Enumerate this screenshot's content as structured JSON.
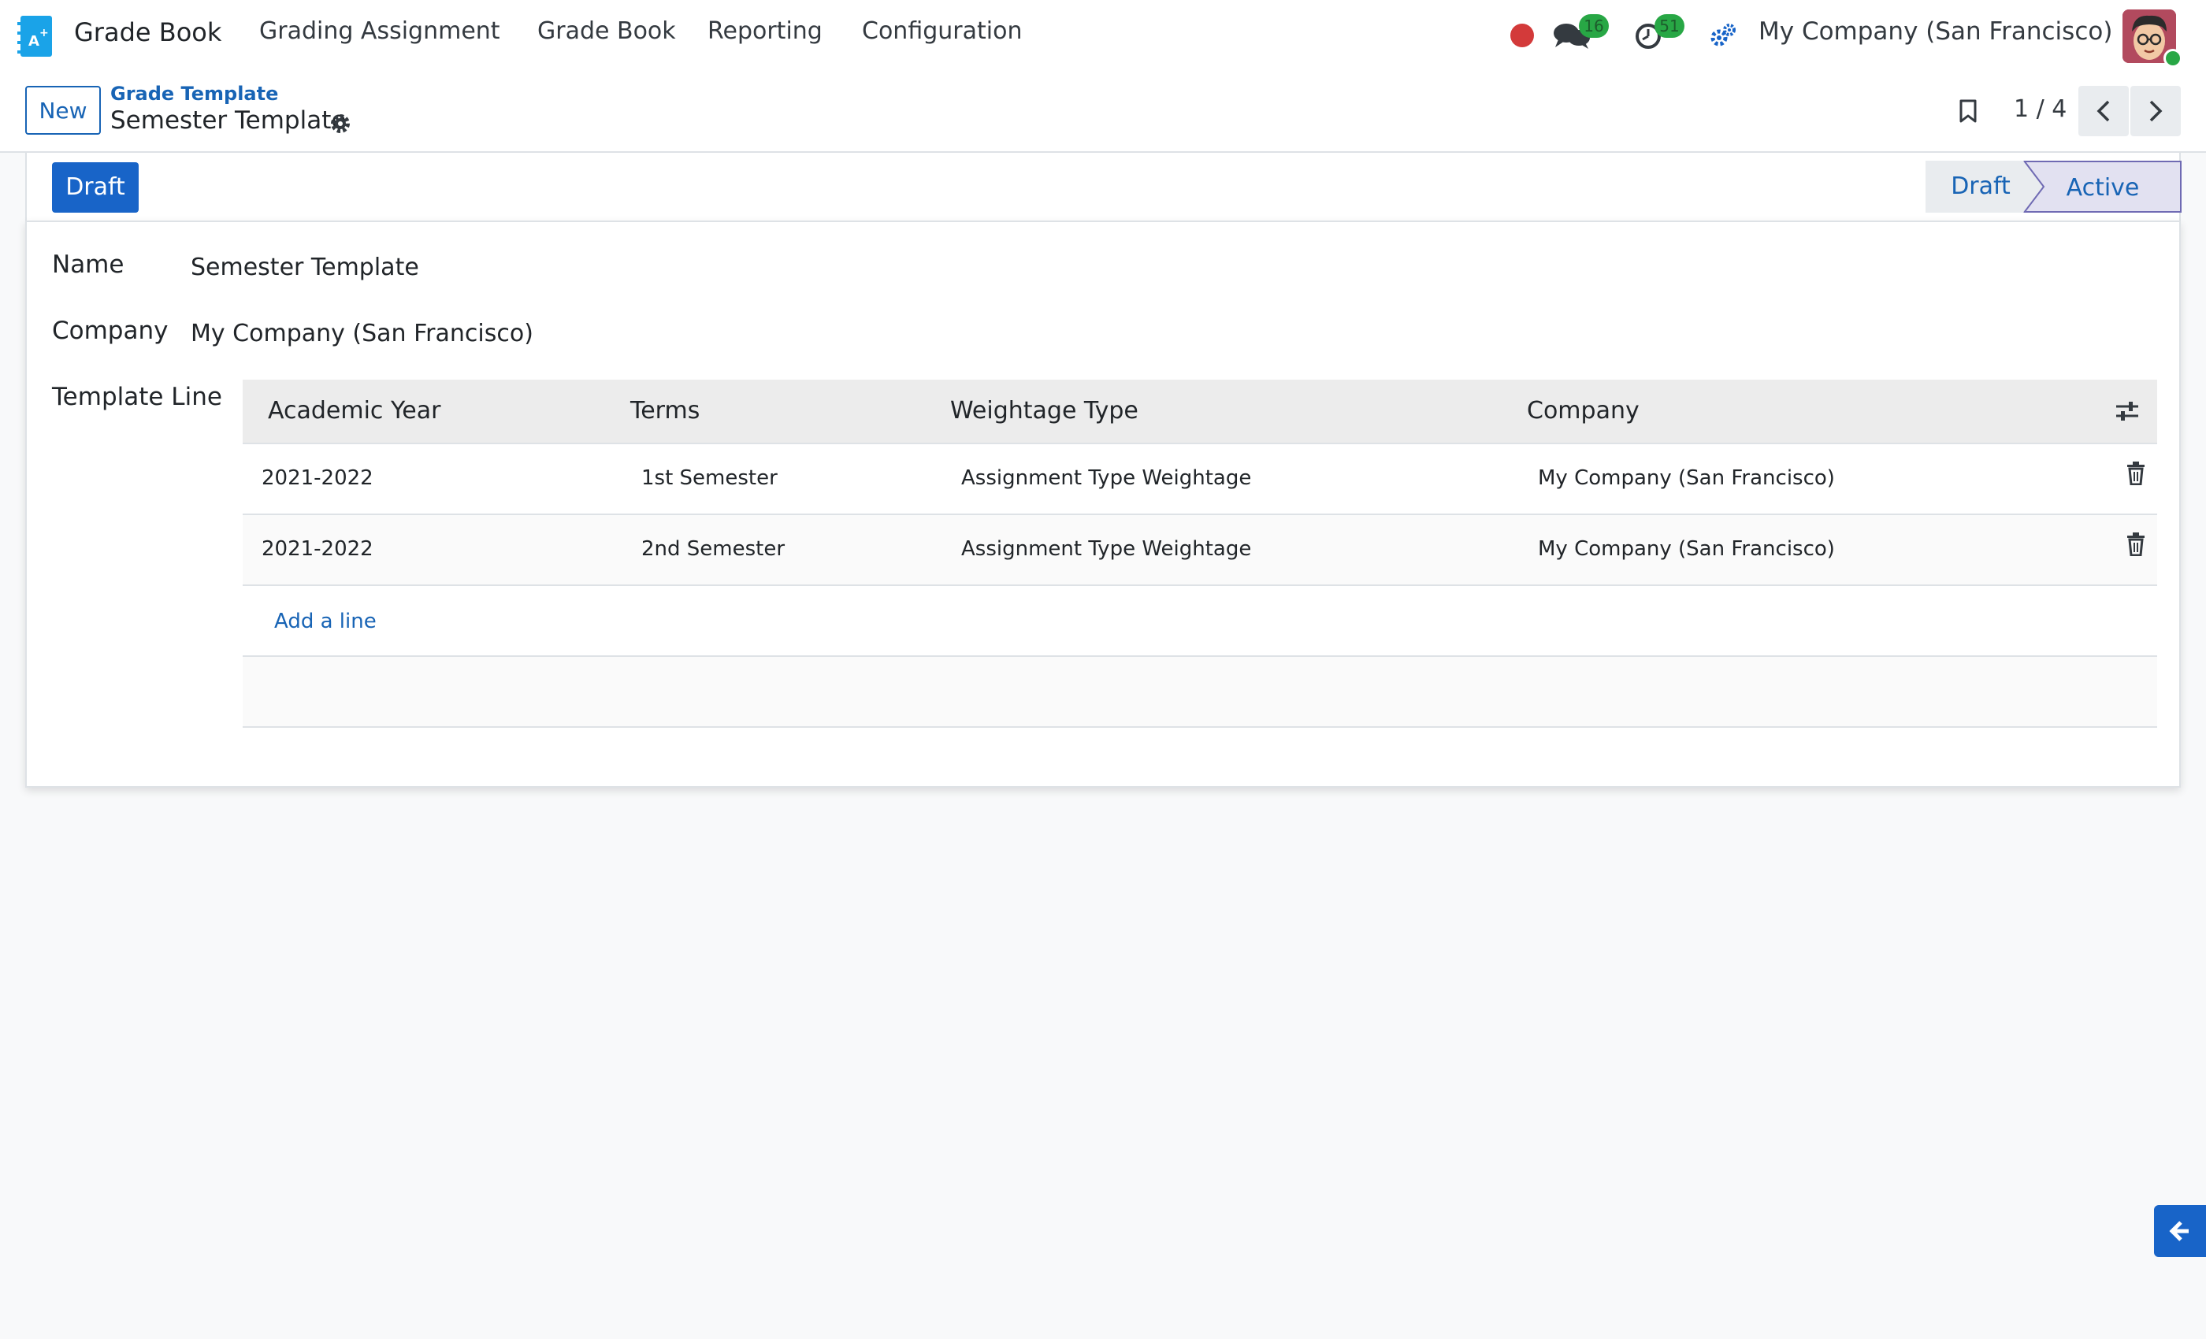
{
  "navbar": {
    "app_name": "Grade Book",
    "menu": [
      "Grading Assignment",
      "Grade Book",
      "Reporting",
      "Configuration"
    ],
    "messages_count": "16",
    "activities_count": "51",
    "company": "My Company (San Francisco)"
  },
  "control": {
    "new_label": "New",
    "breadcrumb_parent": "Grade Template",
    "record_title": "Semester Template",
    "pager": "1 / 4"
  },
  "statusbar": {
    "action_label": "Draft",
    "stages": [
      "Draft",
      "Active"
    ],
    "current_stage": "Active"
  },
  "form": {
    "name_label": "Name",
    "name_value": "Semester Template",
    "company_label": "Company",
    "company_value": "My Company (San Francisco)",
    "lines_label": "Template Line",
    "columns": [
      "Academic Year",
      "Terms",
      "Weightage Type",
      "Company"
    ],
    "rows": [
      {
        "year": "2021-2022",
        "term": "1st Semester",
        "weightage": "Assignment Type Weightage",
        "company": "My Company (San Francisco)"
      },
      {
        "year": "2021-2022",
        "term": "2nd Semester",
        "weightage": "Assignment Type Weightage",
        "company": "My Company (San Francisco)"
      }
    ],
    "add_line_label": "Add a line"
  },
  "colors": {
    "primary": "#1864c8",
    "link": "#1864b5",
    "badge": "#28a745",
    "record_dot": "#d33a3a"
  }
}
